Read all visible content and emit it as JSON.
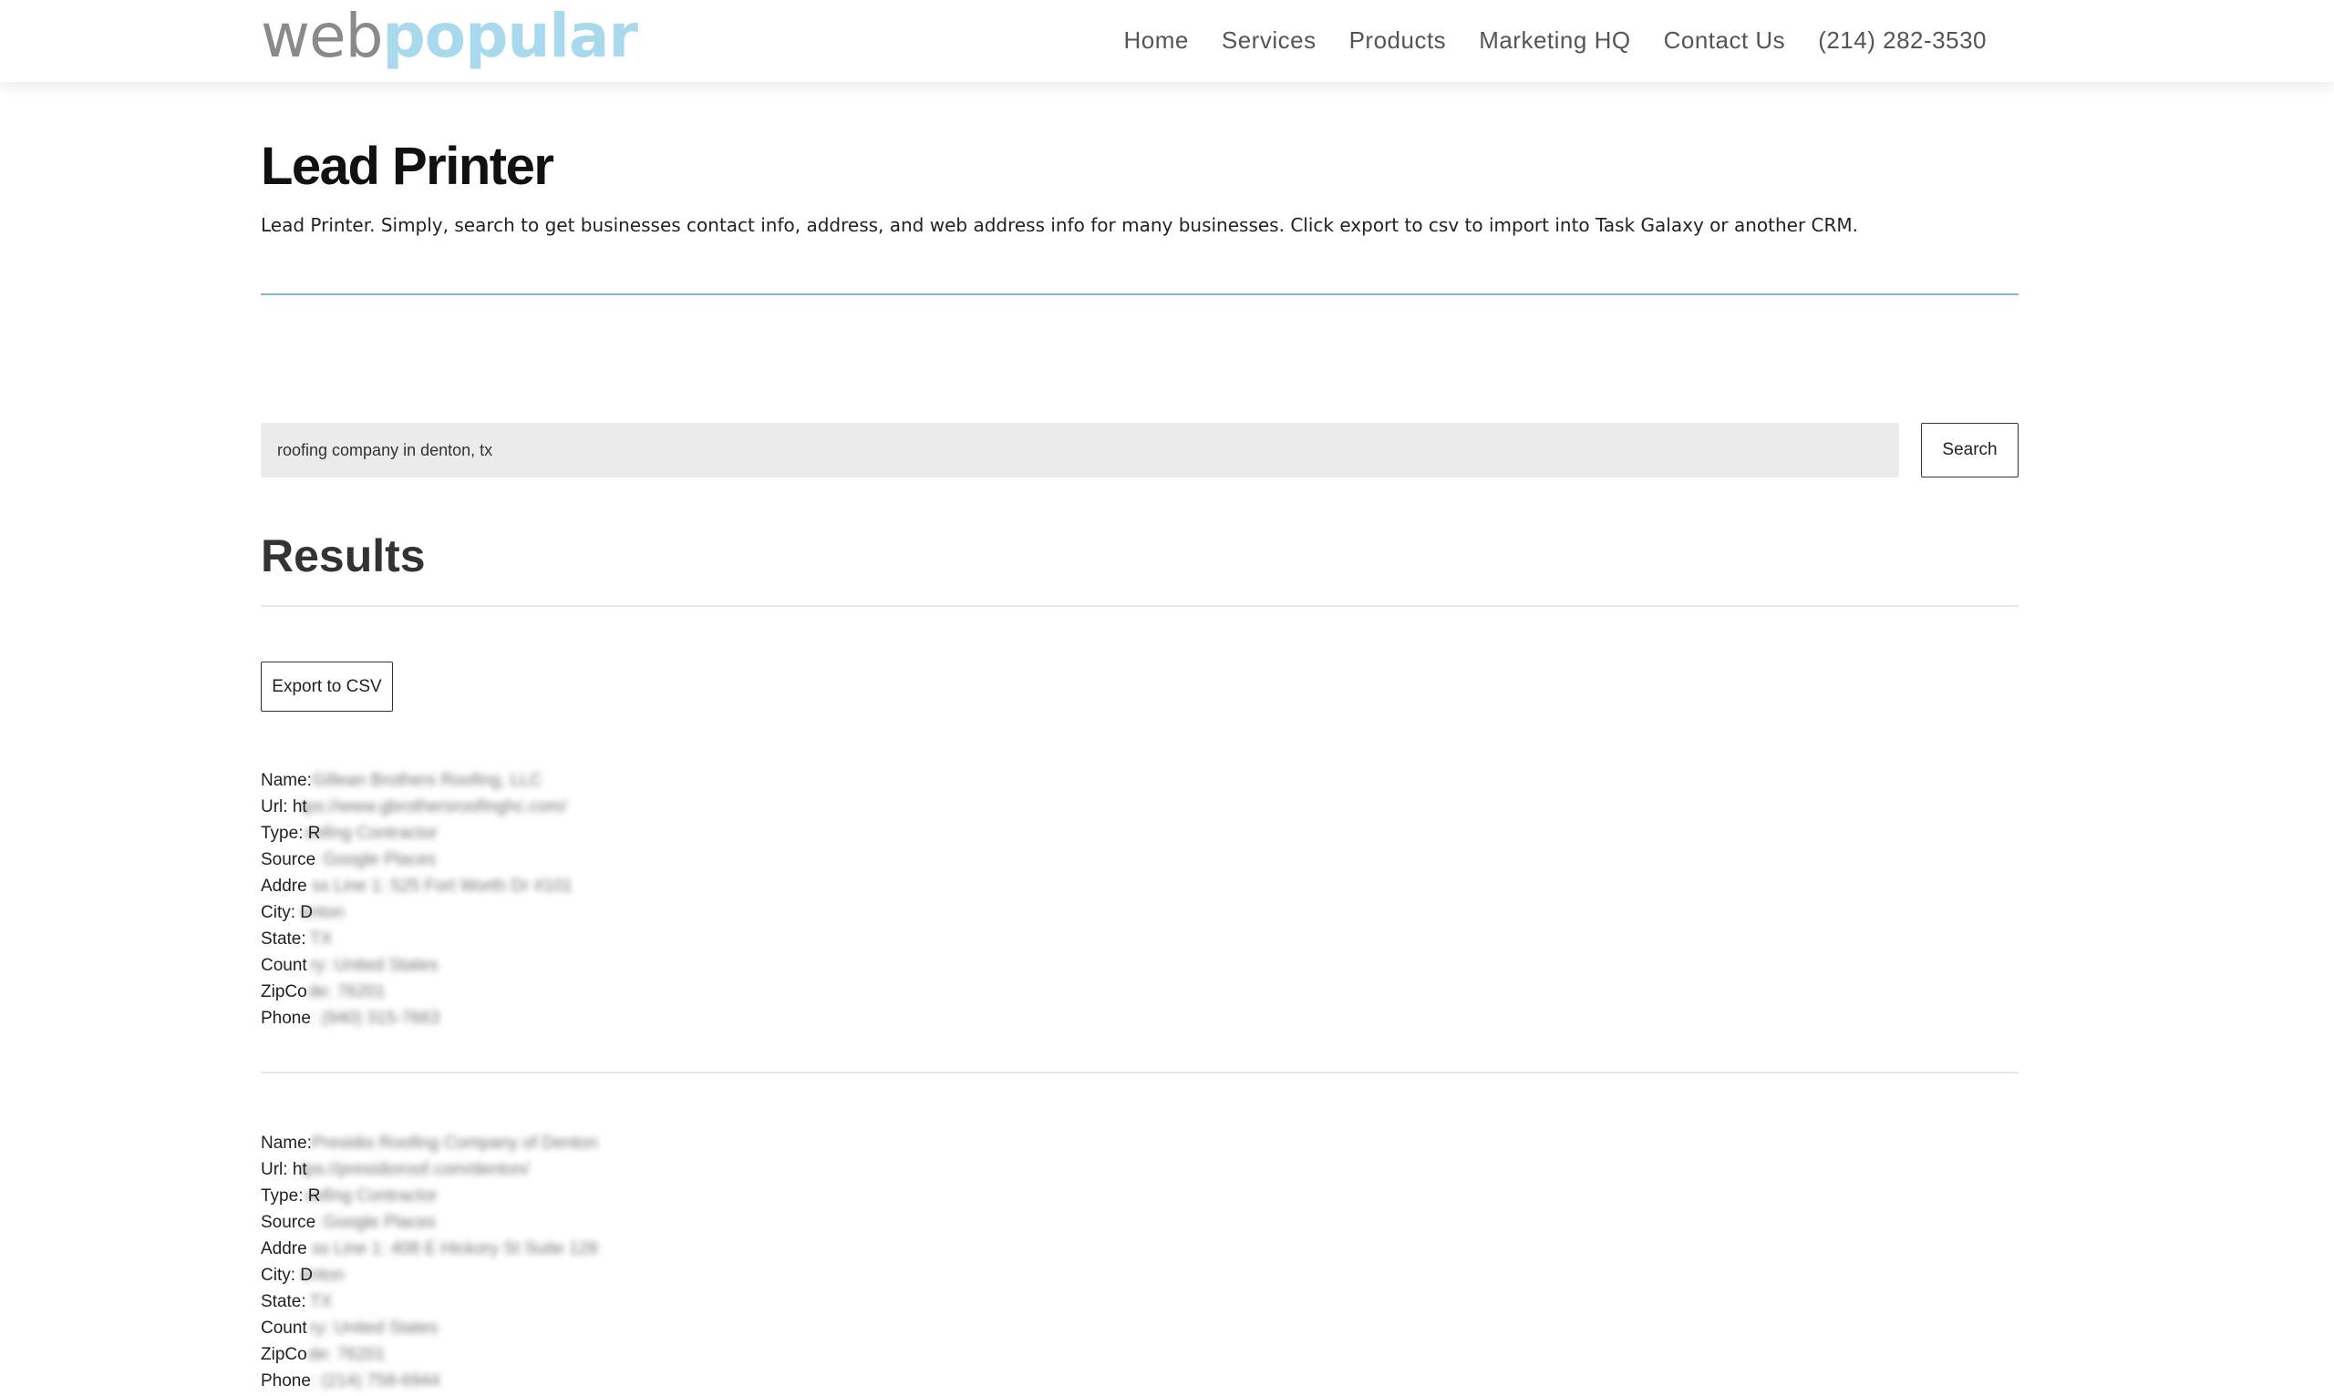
{
  "header": {
    "logo_part1": "web",
    "logo_part2": "popular",
    "nav": [
      "Home",
      "Services",
      "Products",
      "Marketing HQ",
      "Contact Us",
      "(214) 282-3530"
    ]
  },
  "page": {
    "title": "Lead Printer",
    "description": "Lead Printer. Simply, search to get businesses contact info, address, and web address info for many businesses. Click export to csv to import into Task Galaxy or another CRM."
  },
  "search": {
    "value": "roofing company in denton, tx",
    "button_label": "Search"
  },
  "results": {
    "heading": "Results",
    "export_label": "Export to CSV",
    "records": [
      {
        "labels": [
          "Name:",
          "Url: ht",
          "Type: R",
          "Source",
          "Addre",
          "City: D",
          "State:",
          "Count",
          "ZipCo",
          "Phone"
        ],
        "values": [
          "Gillean Brothers Roofing, LLC",
          "tps://www.gbrothersroofinghc.com/",
          "oofing Contractor",
          ": Google Places",
          "ss Line 1: 525 Fort Worth Dr #101",
          "enton",
          "TX",
          "ry: United States",
          "de: 76201",
          ": (940) 315-7663"
        ]
      },
      {
        "labels": [
          "Name:",
          "Url: ht",
          "Type: R",
          "Source",
          "Addre",
          "City: D",
          "State:",
          "Count",
          "ZipCo",
          "Phone"
        ],
        "values": [
          "Presidio Roofing Company of Denton",
          "tps://presidioroof.com/denton/",
          "oofing Contractor",
          ": Google Places",
          "ss Line 1: 408 E Hickory St Suite 128",
          "enton",
          "TX",
          "ry: United States",
          "de: 76201",
          ": (214) 758-6944"
        ]
      }
    ]
  },
  "colors": {
    "logo_web": "#8a8a8a",
    "logo_popular": "#a9d9ec",
    "title_rule": "#7fb9cc"
  }
}
